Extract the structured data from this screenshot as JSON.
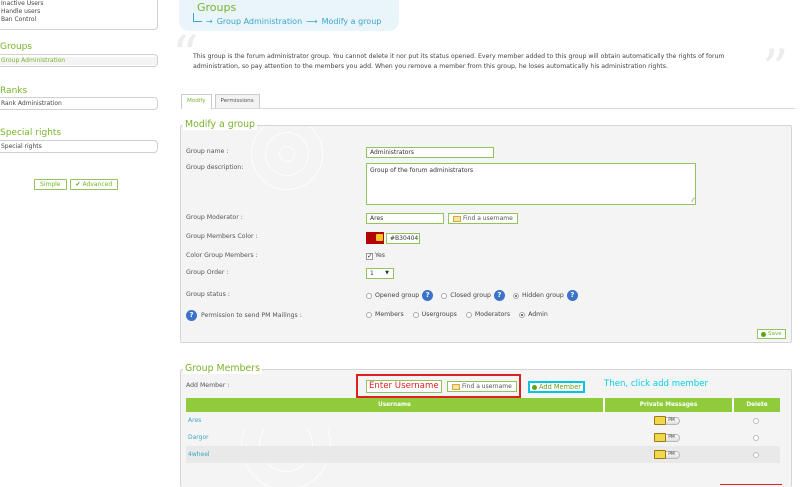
{
  "sidebar": {
    "top_items": [
      "Inactive Users",
      "Handle users",
      "Ban Control"
    ],
    "groups": {
      "title": "Groups",
      "items": [
        "Group Administration"
      ]
    },
    "ranks": {
      "title": "Ranks",
      "items": [
        "Rank Administration"
      ]
    },
    "special_rights": {
      "title": "Special rights",
      "items": [
        "Special rights"
      ]
    },
    "mode_buttons": {
      "simple": "Simple",
      "advanced": "Advanced"
    }
  },
  "header": {
    "title": "Groups",
    "breadcrumb": [
      "Group Administration",
      "Modify a group"
    ]
  },
  "description": "This group is the forum administrator group. You cannot delete it nor put its status opened. Every member added to this group will obtain automatically the rights of forum administration, so pay attention to the members you add. When you remove a member from this group, he loses automatically his administration rights.",
  "tabs": [
    "Modify",
    "Permissions"
  ],
  "modify": {
    "legend": "Modify a group",
    "group_name_label": "Group name :",
    "group_name_value": "Administrators",
    "description_label": "Group description:",
    "description_value": "Group of the forum administrators",
    "moderator_label": "Group Moderator :",
    "moderator_value": "Ares",
    "find_username": "Find a username",
    "color_label": "Group Members Color :",
    "color_value": "#B30404",
    "color_members_label": "Color Group Members :",
    "color_members_value": "Yes",
    "order_label": "Group Order :",
    "order_value": "1",
    "status_label": "Group status :",
    "status_options": [
      "Opened group",
      "Closed group",
      "Hidden group"
    ],
    "status_selected": "Hidden group",
    "pm_label": "Permission to send PM Mailings :",
    "pm_options": [
      "Members",
      "Usergroups",
      "Moderators",
      "Admin"
    ],
    "pm_selected": "Admin",
    "save": "Save"
  },
  "members": {
    "legend": "Group Members",
    "add_label": "Add Member :",
    "enter_username": "Enter Username",
    "find_username": "Find a username",
    "add_button": "Add Member",
    "hint": "Then, click add member",
    "columns": [
      "Username",
      "Private Messages",
      "Delete"
    ],
    "pm_button": "PM",
    "rows": [
      {
        "username": "Ares"
      },
      {
        "username": "Dargor"
      },
      {
        "username": "4wheel"
      }
    ]
  },
  "colors": {
    "accent": "#78b32a",
    "link": "#3aa6c9",
    "table_header": "#8fcb3a",
    "annotation_red": "#e02020",
    "annotation_cyan": "#00c8dc"
  }
}
